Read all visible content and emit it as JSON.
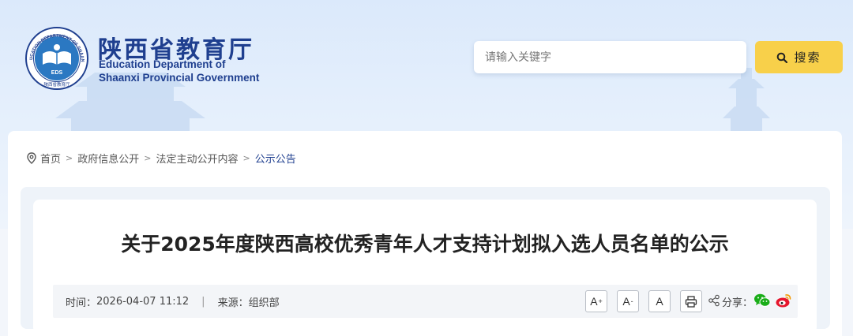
{
  "header": {
    "logo_badge": "EDS",
    "logo_ring_text": "EDUCATION DEPARTMENT OF SHAANXI",
    "logo_seal_text": "陕西省教育厅",
    "logo_cn": "陕西省教育厅",
    "logo_en_line1": "Education Department of",
    "logo_en_line2": "Shaanxi Provincial Government"
  },
  "search": {
    "placeholder": "请输入关键字",
    "button_label": "搜索"
  },
  "breadcrumb": {
    "items": [
      "首页",
      "政府信息公开",
      "法定主动公开内容",
      "公示公告"
    ],
    "separator": ">"
  },
  "article": {
    "title": "关于2025年度陕西高校优秀青年人才支持计划拟入选人员名单的公示",
    "time_label": "时间：",
    "time_value": "2026-04-07 11:12",
    "divider": "|",
    "source_label": "来源：",
    "source_value": "组织部"
  },
  "toolbar": {
    "font_increase": "A",
    "font_increase_mark": "+",
    "font_decrease": "A",
    "font_decrease_mark": "-",
    "font_default": "A",
    "share_label": "分享："
  },
  "colors": {
    "brand_blue": "#1f3f8f",
    "search_button": "#f8d04a",
    "wechat": "#1aad19",
    "weibo": "#e6162d"
  }
}
